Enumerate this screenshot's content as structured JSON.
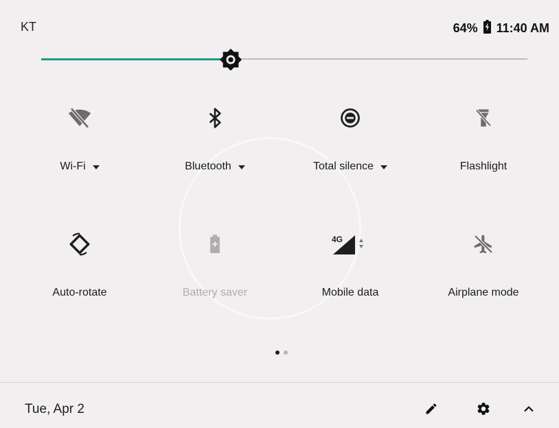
{
  "status": {
    "carrier": "KT",
    "battery": "64%",
    "time": "11:40 AM"
  },
  "brightness": {
    "level": 0.39
  },
  "tiles": [
    {
      "label": "Wi-Fi",
      "icon": "wifi-off-icon",
      "has_dropdown": true,
      "state": "off"
    },
    {
      "label": "Bluetooth",
      "icon": "bluetooth-icon",
      "has_dropdown": true,
      "state": "on"
    },
    {
      "label": "Total silence",
      "icon": "do-not-disturb-icon",
      "has_dropdown": true,
      "state": "on"
    },
    {
      "label": "Flashlight",
      "icon": "flashlight-off-icon",
      "has_dropdown": false,
      "state": "off"
    },
    {
      "label": "Auto-rotate",
      "icon": "auto-rotate-icon",
      "has_dropdown": false,
      "state": "on"
    },
    {
      "label": "Battery saver",
      "icon": "battery-saver-icon",
      "has_dropdown": false,
      "state": "disabled"
    },
    {
      "label": "Mobile data",
      "icon": "mobile-data-icon",
      "has_dropdown": false,
      "state": "on",
      "network": "4G"
    },
    {
      "label": "Airplane mode",
      "icon": "airplane-mode-off-icon",
      "has_dropdown": false,
      "state": "off"
    }
  ],
  "pager": {
    "pages": 2,
    "current": 1
  },
  "footer": {
    "date": "Tue, Apr 2",
    "edit_icon": "pencil-icon",
    "settings_icon": "gear-icon",
    "collapse_icon": "chevron-up-icon"
  },
  "colors": {
    "background": "#f2eff0",
    "accent": "#1a9a84",
    "icon": "#1e1e1e",
    "icon_off": "#6f6a6b",
    "disabled": "#b1acad"
  }
}
